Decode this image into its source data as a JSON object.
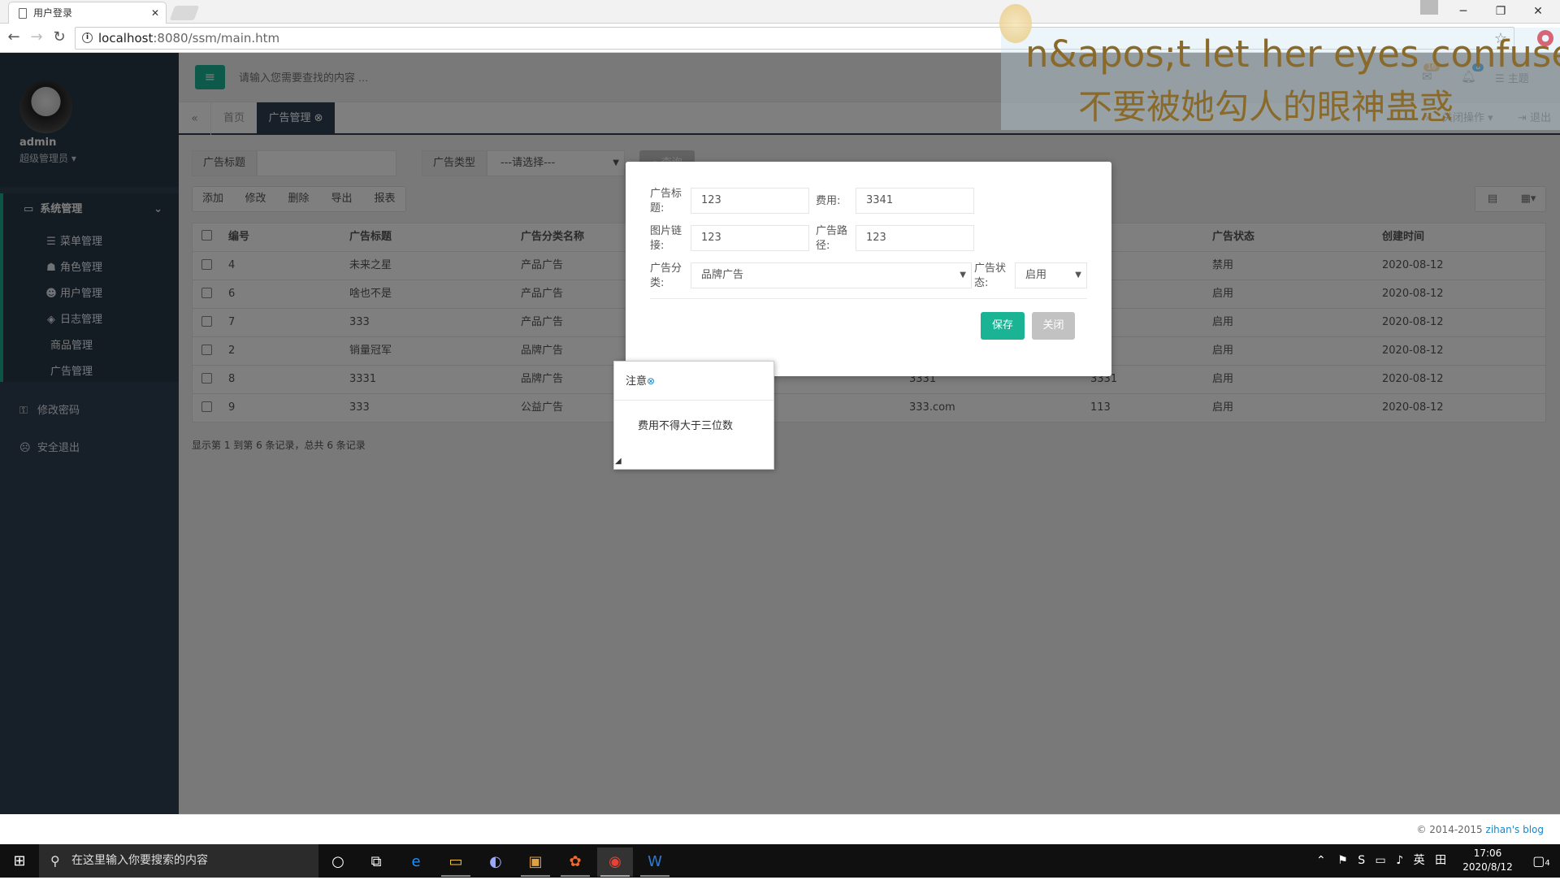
{
  "browser": {
    "tab_title": "用户登录",
    "tab_close": "✕",
    "url_host": "localhost",
    "url_path": ":8080/ssm/main.htm",
    "window_buttons": [
      "─",
      "❐",
      "✕"
    ]
  },
  "sidebar": {
    "user_name": "admin",
    "user_role": "超级管理员 ▾",
    "menu_title": "系统管理",
    "items": [
      {
        "icon": "sliders-icon",
        "glyph": "☰",
        "label": "菜单管理"
      },
      {
        "icon": "users-icon",
        "glyph": "☗",
        "label": "角色管理"
      },
      {
        "icon": "user-icon",
        "glyph": "☻",
        "label": "用户管理"
      },
      {
        "icon": "tags-icon",
        "glyph": "◈",
        "label": "日志管理"
      },
      {
        "icon": "",
        "glyph": "",
        "label": "商品管理"
      },
      {
        "icon": "",
        "glyph": "",
        "label": "广告管理"
      }
    ],
    "change_password": "修改密码",
    "logout": "安全退出"
  },
  "topnav": {
    "search_placeholder": "请输入您需要查找的内容 …",
    "mail_badge": "16",
    "bell_badge": "8",
    "theme": "主题"
  },
  "tabs": {
    "home": "首页",
    "active": "广告管理",
    "close_ops": "关闭操作 ▾",
    "exit": "退出"
  },
  "filter": {
    "title_label": "广告标题",
    "type_label": "广告类型",
    "type_select": "---请选择---",
    "search_button": "查询"
  },
  "toolbar": {
    "add": "添加",
    "edit": "修改",
    "delete": "删除",
    "export": "导出",
    "report": "报表"
  },
  "table": {
    "headers": [
      "编号",
      "广告标题",
      "广告分类名称",
      "",
      "",
      "广告状态",
      "创建时间"
    ],
    "rows": [
      {
        "id": "4",
        "title": "未来之星",
        "category": "产品广告",
        "link": "",
        "path": "",
        "status": "禁用",
        "created": "2020-08-12"
      },
      {
        "id": "6",
        "title": "啥也不是",
        "category": "产品广告",
        "link": "",
        "path": "",
        "status": "启用",
        "created": "2020-08-12"
      },
      {
        "id": "7",
        "title": "333",
        "category": "产品广告",
        "link": "",
        "path": "",
        "status": "启用",
        "created": "2020-08-12"
      },
      {
        "id": "2",
        "title": "销量冠军",
        "category": "品牌广告",
        "link": "",
        "path": "",
        "status": "启用",
        "created": "2020-08-12"
      },
      {
        "id": "8",
        "title": "3331",
        "category": "品牌广告",
        "link": "3331",
        "path": "3331",
        "status": "启用",
        "created": "2020-08-12"
      },
      {
        "id": "9",
        "title": "333",
        "category": "公益广告",
        "link": "333.com",
        "path": "113",
        "status": "启用",
        "created": "2020-08-12"
      }
    ],
    "pager": "显示第 1 到第 6 条记录，总共 6 条记录"
  },
  "modal": {
    "title_label": "广告标题:",
    "title_value": "123",
    "fee_label": "费用:",
    "fee_value": "3341",
    "img_label": "图片链接:",
    "img_value": "123",
    "path_label": "广告路径:",
    "path_value": "123",
    "category_label": "广告分类:",
    "category_value": "品牌广告",
    "status_label": "广告状态:",
    "status_value": "启用",
    "save": "保存",
    "close": "关闭"
  },
  "alert": {
    "title": "注意",
    "close_glyph": "⊗",
    "message": "费用不得大于三位数"
  },
  "footer": {
    "copyright": "© 2014-2015 ",
    "blog": "zihan's blog"
  },
  "lyrics": {
    "english": "n&apos;t let her eyes confuse",
    "chinese": "不要被她勾人的眼神蛊惑"
  },
  "taskbar": {
    "search_placeholder": "在这里输入你要搜索的内容",
    "tray_lang": "英",
    "time": "17:06",
    "date": "2020/8/12",
    "notif_count": "4"
  },
  "colors": {
    "sidebar": "#2f4050",
    "accent": "#1ab394",
    "link": "#1c84c6"
  }
}
